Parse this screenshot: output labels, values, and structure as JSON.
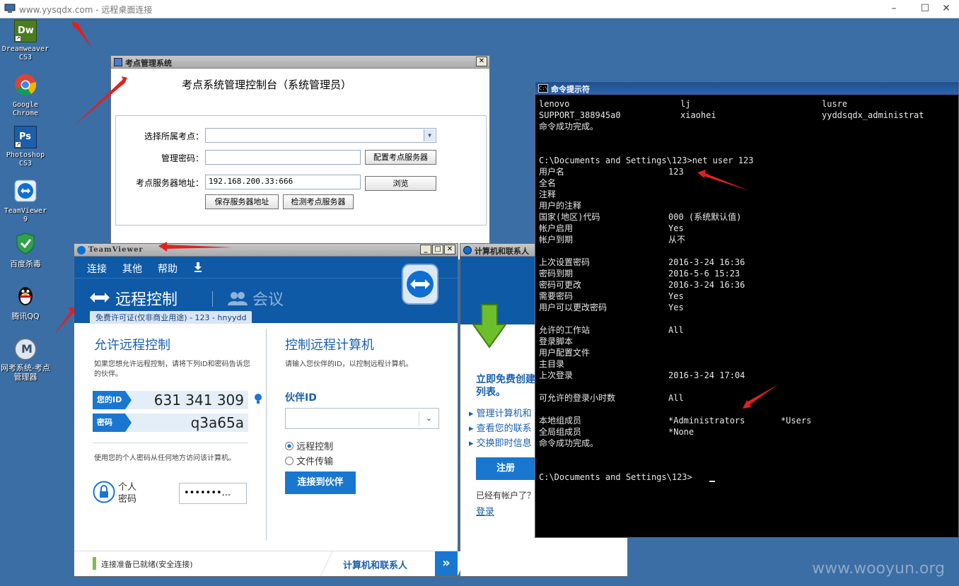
{
  "rdp": {
    "title": "www.yysqdx.com - 远程桌面连接",
    "min": "–",
    "max": "☐",
    "close": "✕"
  },
  "desktop_icons": [
    {
      "label": "Dreamweaver CS3",
      "short": "Dw"
    },
    {
      "label": "Google Chrome",
      "short": ""
    },
    {
      "label": "Photoshop CS3",
      "short": "Ps"
    },
    {
      "label": "TeamViewer 9",
      "short": ""
    },
    {
      "label": "百度杀毒",
      "short": ""
    },
    {
      "label": "腾讯QQ",
      "short": ""
    },
    {
      "label": "网考系统-考点管理器",
      "short": "M"
    }
  ],
  "exam": {
    "title": "考点管理系统",
    "heading": "考点系统管理控制台（系统管理员）",
    "site_label": "选择所属考点：",
    "password_label": "管理密码：",
    "server_label": "考点服务器地址：",
    "server_value": "192.168.200.33:666",
    "config_btn": "配置考点服务器",
    "browse_btn": "浏览",
    "save_btn": "保存服务器地址",
    "check_btn": "检测考点服务器",
    "close": "✕"
  },
  "tv": {
    "title": "TeamViewer",
    "menu": [
      "连接",
      "其他",
      "帮助"
    ],
    "tab_remote": "远程控制",
    "tab_meeting": "会议",
    "license": "免费许可证(仅非商业用途) - 123 - hnyydd",
    "allow_title": "允许远程控制",
    "allow_desc": "如果您想允许远程控制，请将下列ID和密码告诉您的伙伴。",
    "id_label": "您的ID",
    "id_value": "631 341 309",
    "pw_label": "密码",
    "pw_value": "q3a65a",
    "personal_desc": "使用您的个人密码从任何地方访问该计算机。",
    "personal_label": "个人密码",
    "personal_value": "•••••••...",
    "control_title": "控制远程计算机",
    "control_desc": "请输入您伙伴的ID，以控制远程计算机。",
    "partner_label": "伙伴ID",
    "opt_remote": "远程控制",
    "opt_file": "文件传输",
    "connect_btn": "连接到伙伴",
    "status": "连接准备已就绪(安全连接)",
    "contacts_tab": "计算机和联系人",
    "win_btns": [
      "_",
      "□",
      "✕"
    ]
  },
  "cc": {
    "title": "计算机和联系人",
    "promo": "立即免费创建",
    "promo2": "列表。",
    "links": [
      "管理计算机和",
      "查看您的联系",
      "交换即时信息"
    ],
    "register_btn": "注册",
    "have_account": "已经有帐户了？",
    "login": "登录"
  },
  "cmd": {
    "title": "命令提示符",
    "icon": "C:\\",
    "users_row1": [
      "lenovo",
      "lj",
      "lusre"
    ],
    "users_row2": [
      "SUPPORT_388945a0",
      "xiaohei",
      "yyddsqdx_administrat"
    ],
    "done1": "命令成功完成。",
    "prompt1": "C:\\Documents and Settings\\123>net user 123",
    "fields": [
      {
        "k": "用户名",
        "v": "123"
      },
      {
        "k": "全名",
        "v": ""
      },
      {
        "k": "注释",
        "v": ""
      },
      {
        "k": "用户的注释",
        "v": ""
      },
      {
        "k": "国家(地区)代码",
        "v": "000 (系统默认值)"
      },
      {
        "k": "帐户启用",
        "v": "Yes"
      },
      {
        "k": "帐户到期",
        "v": "从不"
      },
      {
        "k": "上次设置密码",
        "v": "2016-3-24 16:36"
      },
      {
        "k": "密码到期",
        "v": "2016-5-6 15:23"
      },
      {
        "k": "密码可更改",
        "v": "2016-3-24 16:36"
      },
      {
        "k": "需要密码",
        "v": "Yes"
      },
      {
        "k": "用户可以更改密码",
        "v": "Yes"
      },
      {
        "k": "允许的工作站",
        "v": "All"
      },
      {
        "k": "登录脚本",
        "v": ""
      },
      {
        "k": "用户配置文件",
        "v": ""
      },
      {
        "k": "主目录",
        "v": ""
      },
      {
        "k": "上次登录",
        "v": "2016-3-24 17:04"
      },
      {
        "k": "可允许的登录小时数",
        "v": "All"
      },
      {
        "k": "本地组成员",
        "v": "*Administrators       *Users"
      },
      {
        "k": "全局组成员",
        "v": "*None"
      }
    ],
    "done2": "命令成功完成。",
    "prompt2": "C:\\Documents and Settings\\123>"
  },
  "watermark": "www.wooyun.org",
  "colors": {
    "desktop": "#3a6ea5",
    "tv_blue": "#0e5aa7",
    "accent_red": "#e02020"
  }
}
